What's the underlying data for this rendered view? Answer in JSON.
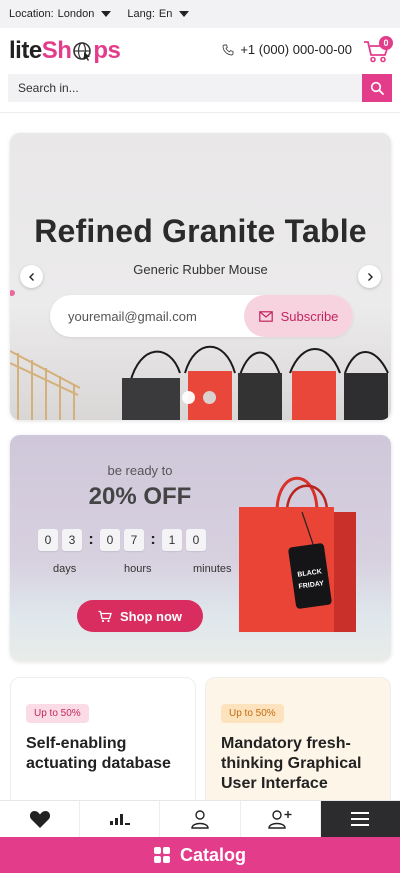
{
  "topbar": {
    "location_label": "Location:",
    "location_value": "London",
    "lang_label": "Lang:",
    "lang_value": "En"
  },
  "header": {
    "logo_part1": "lite",
    "logo_part2a": "Sh",
    "logo_part2b": "ps",
    "phone": "+1 (000) 000-00-00",
    "cart_count": "0"
  },
  "search": {
    "placeholder": "Search in..."
  },
  "hero": {
    "title": "Refined Granite Table",
    "subtitle": "Generic Rubber Mouse",
    "email_placeholder": "youremail@gmail.com",
    "subscribe_label": "Subscribe",
    "active_slide": 1,
    "slide_count": 2
  },
  "promo": {
    "ready": "be ready to",
    "headline": "20% OFF",
    "digits": [
      "0",
      "3",
      "0",
      "7",
      "1",
      "0"
    ],
    "labels": {
      "days": "days",
      "hours": "hours",
      "minutes": "minutes"
    },
    "bag_tag_line1": "BLACK",
    "bag_tag_line2": "FRIDAY",
    "shop_label": "Shop now"
  },
  "cards": [
    {
      "badge": "Up to 50%",
      "title": "Self-enabling actuating database"
    },
    {
      "badge": "Up to 50%",
      "title": "Mandatory fresh-thinking Graphical User Interface"
    }
  ],
  "bottom_nav": {
    "icons": [
      "heart-icon",
      "stats-icon",
      "user-icon",
      "add-user-icon",
      "menu-icon"
    ],
    "active": "menu-icon"
  },
  "catalog": {
    "label": "Catalog"
  },
  "colors": {
    "brand": "#e33c8b",
    "promo_button": "#d92d5f",
    "dark": "#2c2c2e"
  }
}
